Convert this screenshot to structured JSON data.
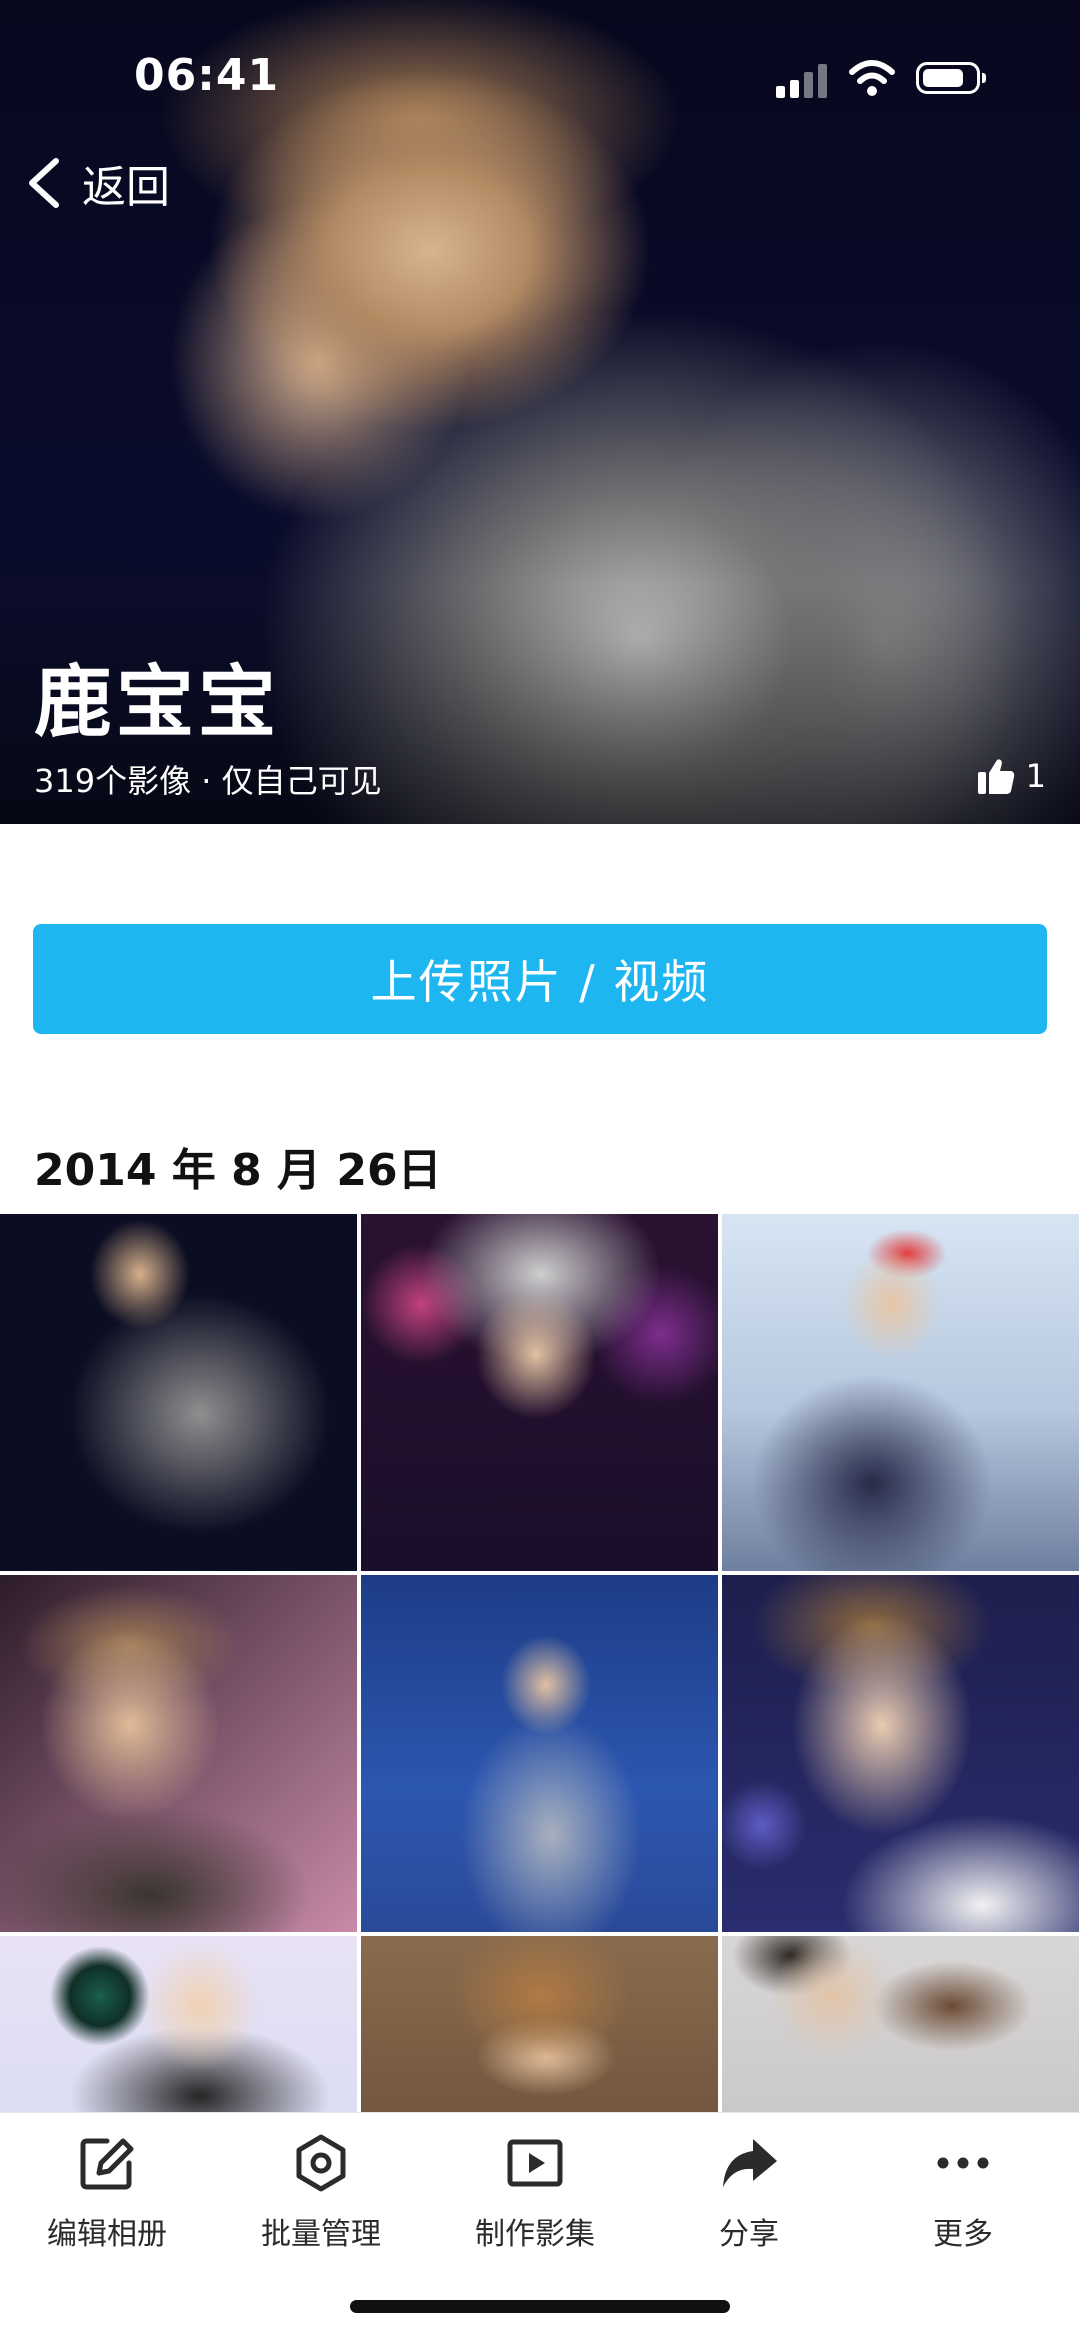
{
  "status_bar": {
    "time": "06:41"
  },
  "header": {
    "back_label": "返回",
    "album_title": "鹿宝宝",
    "album_meta": "319个影像 · 仅自己可见",
    "like_count": "1"
  },
  "upload": {
    "label": "上传照片 / 视频"
  },
  "section": {
    "date": "2014 年 8 月 26日"
  },
  "photos": [
    {
      "description": "stage-photo-1"
    },
    {
      "description": "stage-photo-2"
    },
    {
      "description": "stage-photo-3"
    },
    {
      "description": "stage-photo-4"
    },
    {
      "description": "stage-photo-5"
    },
    {
      "description": "stage-photo-6"
    },
    {
      "description": "stage-photo-7"
    },
    {
      "description": "stage-photo-8"
    },
    {
      "description": "stage-photo-9"
    }
  ],
  "bottom_bar": {
    "items": [
      {
        "label": "编辑相册",
        "icon": "edit-icon"
      },
      {
        "label": "批量管理",
        "icon": "batch-manage-icon"
      },
      {
        "label": "制作影集",
        "icon": "play-icon"
      },
      {
        "label": "分享",
        "icon": "share-icon"
      },
      {
        "label": "更多",
        "icon": "more-icon"
      }
    ]
  },
  "colors": {
    "accent": "#1eb6f0",
    "icon": "#2b2b2b"
  }
}
